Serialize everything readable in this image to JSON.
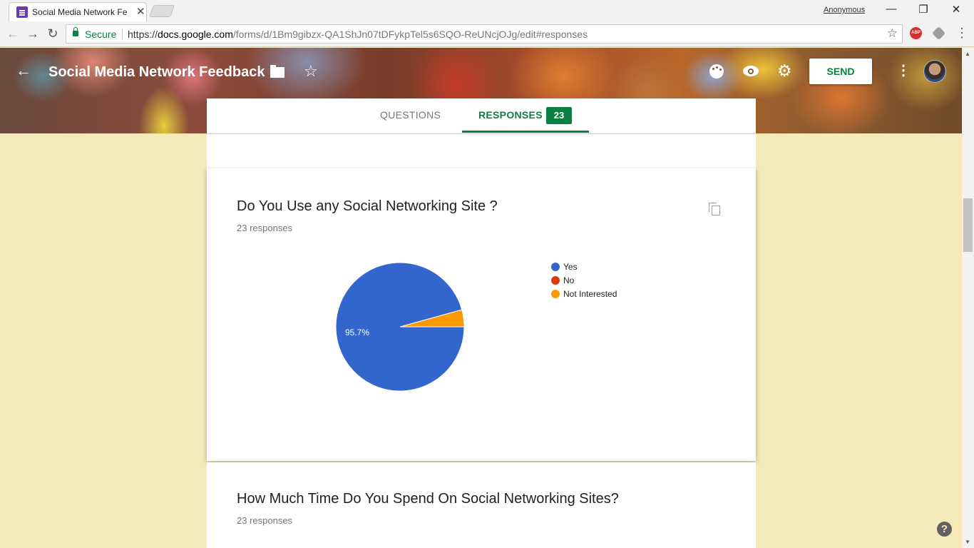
{
  "browser": {
    "tab_title": "Social Media Network Fe",
    "tab_close": "✕",
    "profile": "Anonymous",
    "window_controls": {
      "minimize": "—",
      "restore": "❐",
      "close": "✕"
    },
    "nav": {
      "back": "←",
      "forward": "→",
      "reload": "↻"
    },
    "secure_label": "Secure",
    "url_scheme": "https://",
    "url_host": "docs.google.com",
    "url_path": "/forms/d/1Bm9gibzx-QA1ShJn07tDFykpTel5s6SQO-ReUNcjOJg/edit#responses",
    "bookmark_icon": "star-outline",
    "extensions": [
      "ABP",
      "extension"
    ],
    "menu_icon": "⋮"
  },
  "header": {
    "back_icon": "←",
    "title": "Social Media Network Feedback",
    "star_icon": "☆",
    "gear_icon": "⚙",
    "send_label": "SEND",
    "more_icon": "⋮"
  },
  "tabs": {
    "questions": "QUESTIONS",
    "responses": "RESPONSES",
    "responses_count": "23"
  },
  "questions": [
    {
      "title": "Do You Use any Social Networking Site ?",
      "responses": "23 responses"
    },
    {
      "title": "How Much Time Do You Spend On Social Networking Sites?",
      "responses": "23 responses"
    }
  ],
  "help_icon": "?",
  "colors": {
    "accent": "#0b8043",
    "background": "#f4e9b8",
    "yes": "#3366cc",
    "no": "#dc3912",
    "not_interested": "#ff9900"
  },
  "chart_data": {
    "type": "pie",
    "categories": [
      "Yes",
      "No",
      "Not Interested"
    ],
    "values": [
      95.7,
      0,
      4.3
    ],
    "slice_labels": [
      "95.7%",
      "",
      ""
    ],
    "colors": [
      "#3366cc",
      "#dc3912",
      "#ff9900"
    ],
    "legend_position": "right"
  }
}
